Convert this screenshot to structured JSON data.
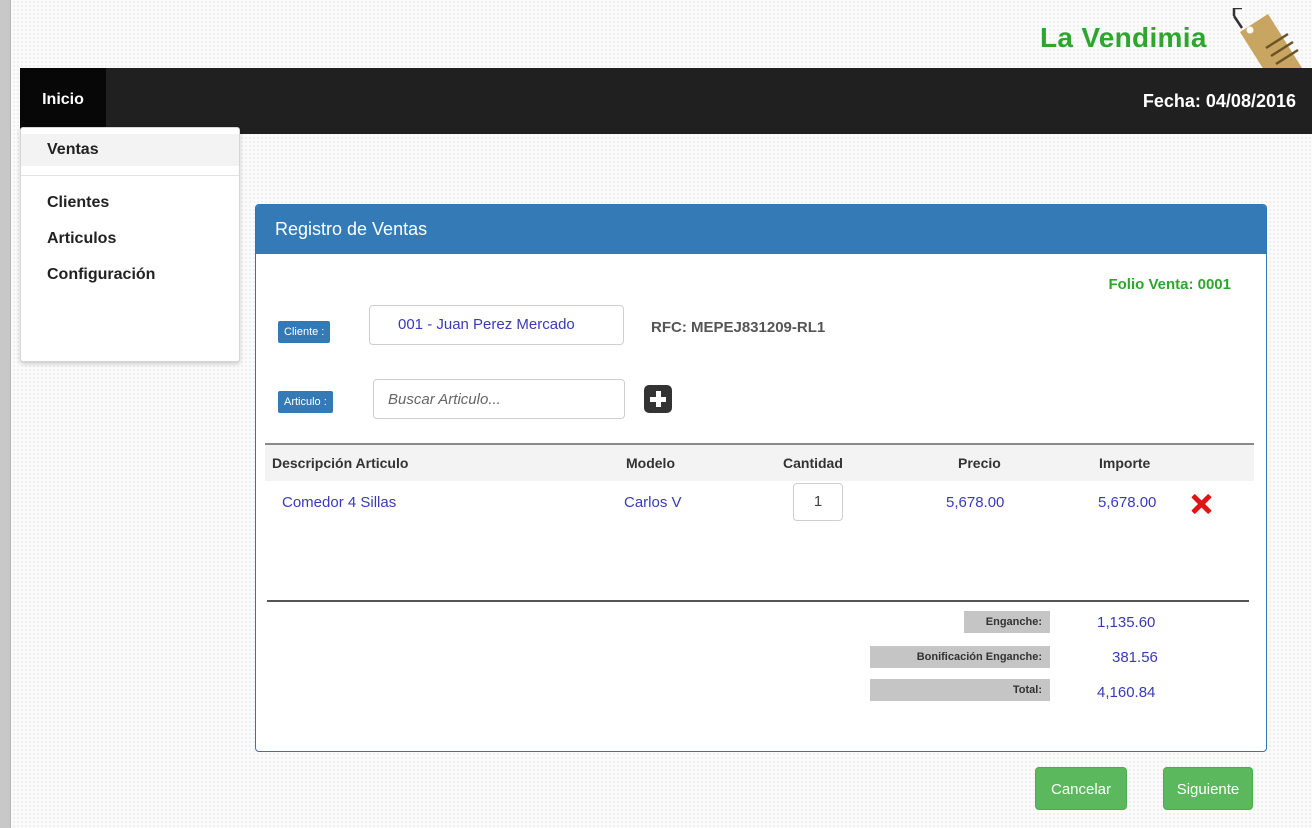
{
  "brand": {
    "name": "La Vendimia",
    "icon": "price-tag-icon"
  },
  "navbar": {
    "home_label": "Inicio",
    "date_text": "Fecha: 04/08/2016"
  },
  "menu": {
    "active_item": "Ventas",
    "items": [
      "Clientes",
      "Articulos",
      "Configuración"
    ]
  },
  "panel": {
    "title": "Registro de Ventas",
    "folio": "Folio Venta: 0001",
    "client_tag": "Cliente :",
    "client_value": "001 - Juan Perez Mercado",
    "rfc": "RFC: MEPEJ831209-RL1",
    "article_tag": "Articulo :",
    "article_placeholder": "Buscar Articulo...",
    "add_icon": "plus-square-icon"
  },
  "table": {
    "headers": [
      "Descripción Articulo",
      "Modelo",
      "Cantidad",
      "Precio",
      "Importe"
    ],
    "rows": [
      {
        "descripcion": "Comedor 4 Sillas",
        "modelo": "Carlos V",
        "cantidad": "1",
        "precio": "5,678.00",
        "importe": "5,678.00",
        "delete_icon": "delete-x-icon"
      }
    ]
  },
  "summary": {
    "enganche_label": "Enganche:",
    "enganche_value": "1,135.60",
    "bonificacion_label": "Bonificación Enganche:",
    "bonificacion_value": "381.56",
    "total_label": "Total:",
    "total_value": "4,160.84"
  },
  "buttons": {
    "cancel": "Cancelar",
    "next": "Siguiente"
  },
  "colors": {
    "brand_green": "#2ea62e",
    "panel_blue": "#337ab7",
    "button_green": "#5cb85c",
    "value_blue": "#3a3ab8",
    "delete_red": "#e01414",
    "navbar": "#202020"
  }
}
